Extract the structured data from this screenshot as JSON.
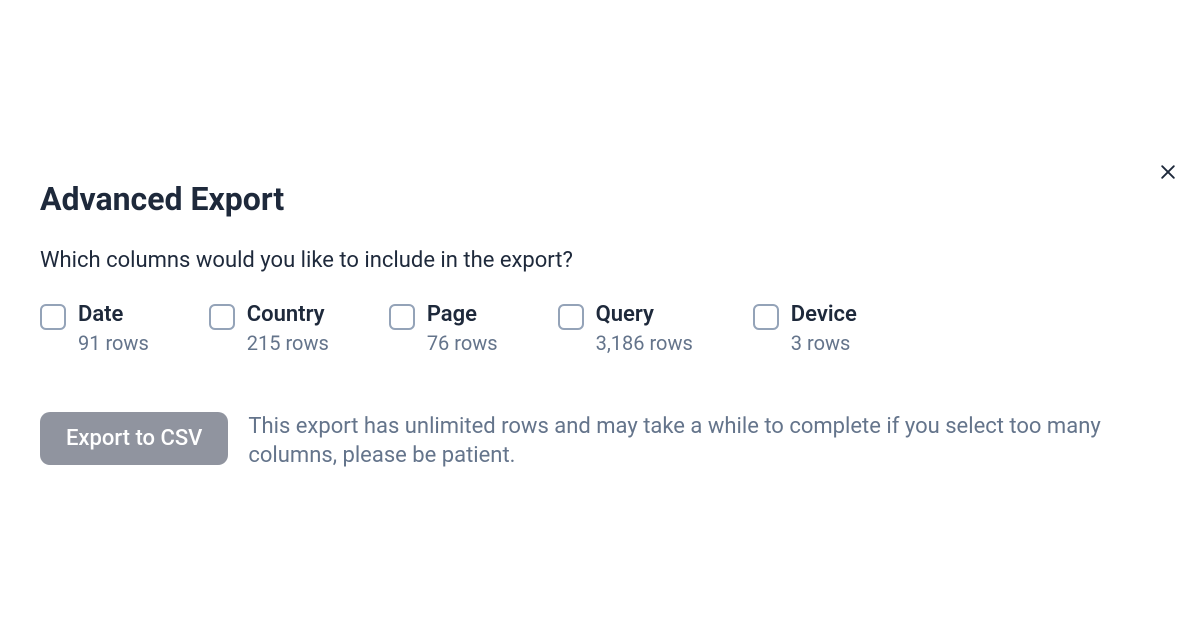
{
  "dialog": {
    "title": "Advanced Export",
    "subtitle": "Which columns would you like to include in the export?",
    "columns": [
      {
        "name": "Date",
        "rows": "91 rows"
      },
      {
        "name": "Country",
        "rows": "215 rows"
      },
      {
        "name": "Page",
        "rows": "76 rows"
      },
      {
        "name": "Query",
        "rows": "3,186 rows"
      },
      {
        "name": "Device",
        "rows": "3 rows"
      }
    ],
    "export_button_label": "Export to CSV",
    "export_note": "This export has unlimited rows and may take a while to complete if you select too many columns, please be patient."
  }
}
